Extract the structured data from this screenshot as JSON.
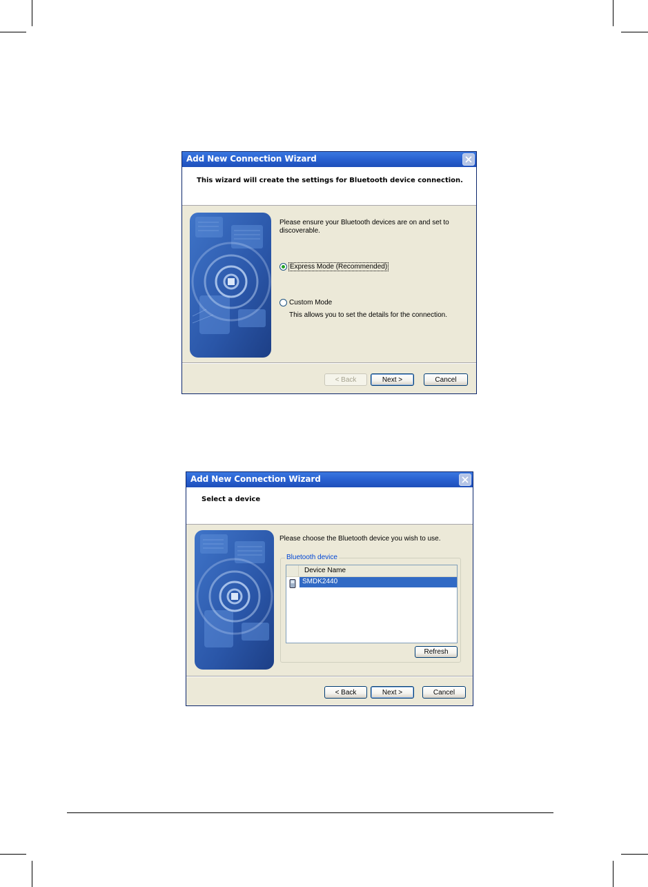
{
  "wizard1": {
    "title": "Add New Connection Wizard",
    "heading": "This wizard will create the settings for Bluetooth device connection.",
    "intro_line1": "Please ensure your Bluetooth devices are on and set to",
    "intro_line2": "discoverable.",
    "express_mode_label": "Express Mode (Recommended)",
    "express_mode_selected": true,
    "custom_mode_label": "Custom Mode",
    "custom_mode_description": "This allows you to set the details for the connection.",
    "back_label": "< Back",
    "next_label": "Next >",
    "cancel_label": "Cancel"
  },
  "wizard2": {
    "title": "Add New Connection Wizard",
    "heading": "Select a device",
    "instruction": "Please choose the Bluetooth device you wish to use.",
    "group_label": "Bluetooth device",
    "column_header": "Device Name",
    "devices": [
      {
        "name": "SMDK2440",
        "selected": true
      }
    ],
    "refresh_label": "Refresh",
    "back_label": "< Back",
    "next_label": "Next >",
    "cancel_label": "Cancel"
  },
  "colors": {
    "titlebar": "#2a62d2",
    "dialog_bg": "#ece9d8",
    "selection": "#316ac5",
    "radio_dot": "#21a121"
  }
}
